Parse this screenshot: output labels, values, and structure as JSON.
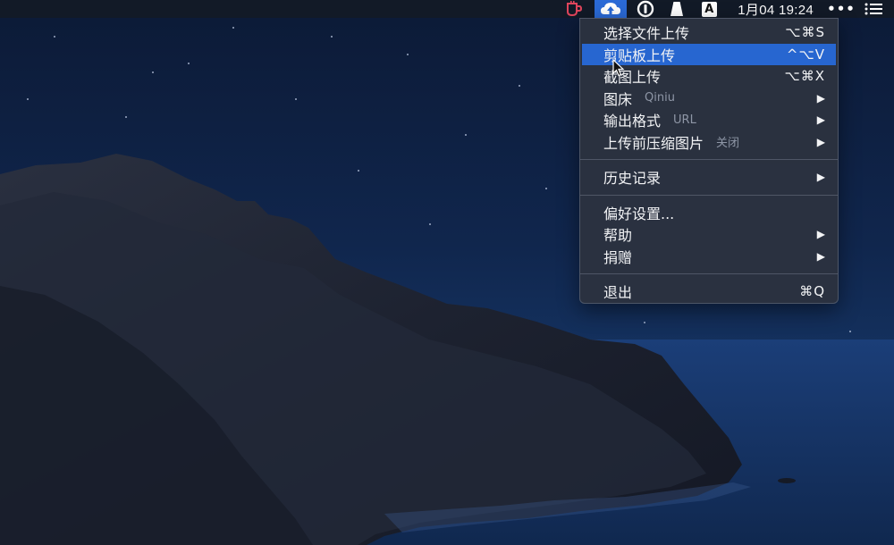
{
  "menubar": {
    "clock": "1月04 19:24",
    "more": "•••",
    "a_label": "A"
  },
  "menu": {
    "items": [
      {
        "label": "选择文件上传",
        "shortcut": "⌥⌘S"
      },
      {
        "label": "剪贴板上传",
        "shortcut": "^⌥V",
        "active": true
      },
      {
        "label": "截图上传",
        "shortcut": "⌥⌘X"
      },
      {
        "label": "图床",
        "sub": "Qiniu",
        "submenu": true
      },
      {
        "label": "输出格式",
        "sub": "URL",
        "submenu": true
      },
      {
        "label": "上传前压缩图片",
        "sub": "关闭",
        "submenu": true
      },
      {
        "label": "历史记录",
        "submenu": true
      },
      {
        "label": "偏好设置..."
      },
      {
        "label": "帮助",
        "submenu": true
      },
      {
        "label": "捐赠",
        "submenu": true
      },
      {
        "label": "退出",
        "shortcut": "⌘Q"
      }
    ],
    "arrow": "▶"
  },
  "colors": {
    "highlight": "#2766d0",
    "menu_bg": "#2c3240",
    "app_icon_bg": "#2b6ad6",
    "cup_icon": "#e0455c"
  }
}
